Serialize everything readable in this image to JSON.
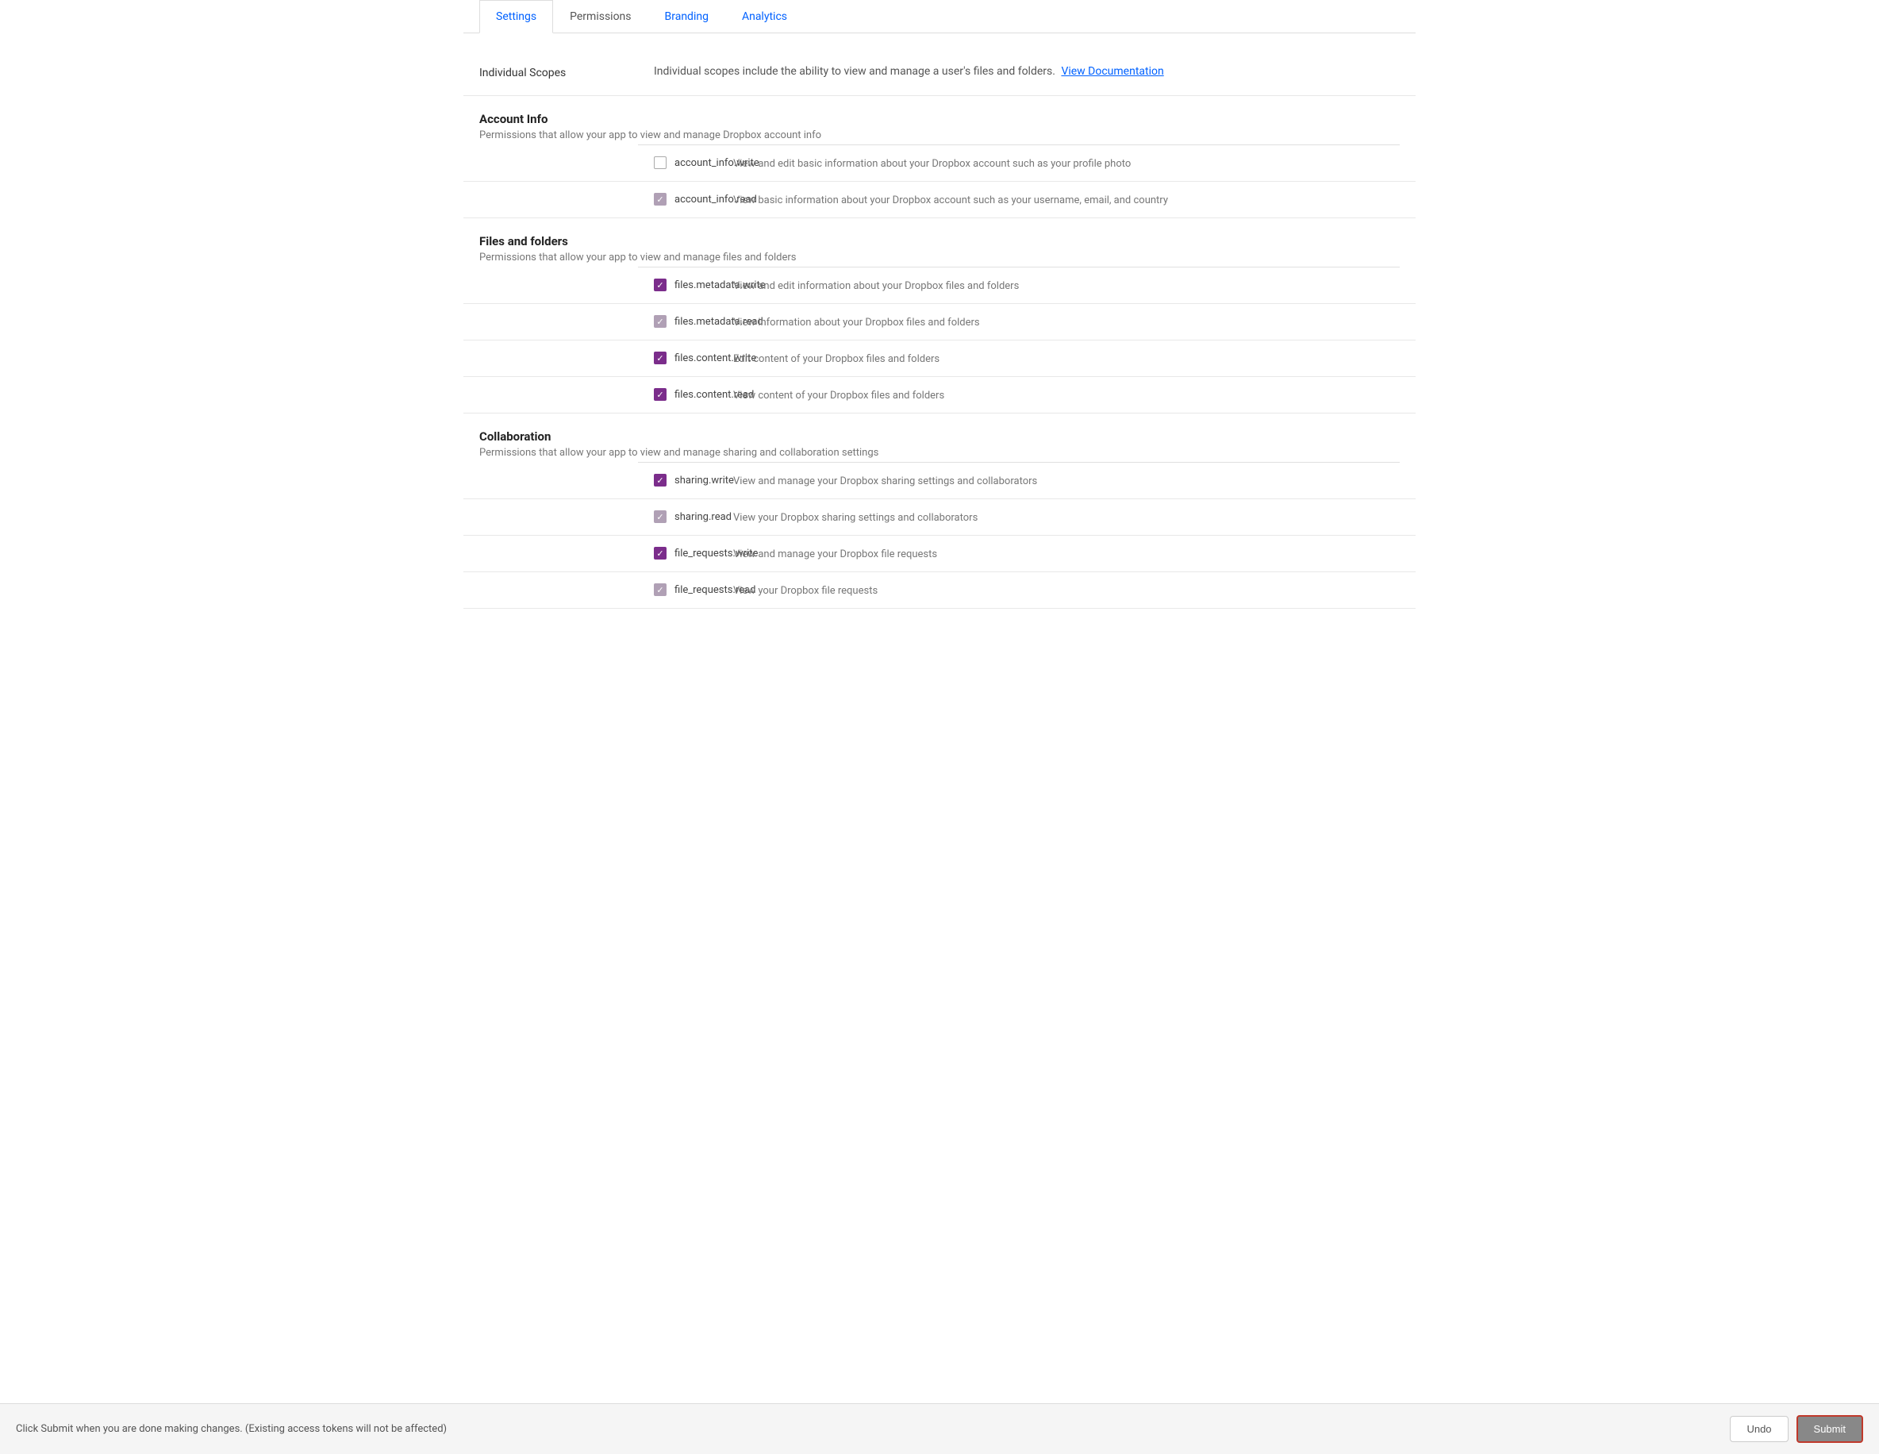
{
  "tabs": [
    {
      "id": "settings",
      "label": "Settings",
      "active": true
    },
    {
      "id": "permissions",
      "label": "Permissions",
      "active": false
    },
    {
      "id": "branding",
      "label": "Branding",
      "active": false
    },
    {
      "id": "analytics",
      "label": "Analytics",
      "active": false
    }
  ],
  "individual_scopes": {
    "label": "Individual Scopes",
    "description": "Individual scopes include the ability to view and manage a user's files and folders.",
    "link_text": "View Documentation",
    "link_href": "#"
  },
  "permission_groups": [
    {
      "id": "account-info",
      "title": "Account Info",
      "subtitle": "Permissions that allow your app to view and manage Dropbox account info",
      "permissions": [
        {
          "id": "account_info_write",
          "name": "account_info.write",
          "checked": false,
          "check_style": "unchecked",
          "description": "View and edit basic information about your Dropbox account such as your profile photo"
        },
        {
          "id": "account_info_read",
          "name": "account_info.read",
          "checked": true,
          "check_style": "gray",
          "description": "View basic information about your Dropbox account such as your username, email, and country"
        }
      ]
    },
    {
      "id": "files-folders",
      "title": "Files and folders",
      "subtitle": "Permissions that allow your app to view and manage files and folders",
      "permissions": [
        {
          "id": "files_metadata_write",
          "name": "files.metadata.write",
          "checked": true,
          "check_style": "purple",
          "description": "View and edit information about your Dropbox files and folders"
        },
        {
          "id": "files_metadata_read",
          "name": "files.metadata.read",
          "checked": true,
          "check_style": "gray",
          "description": "View information about your Dropbox files and folders"
        },
        {
          "id": "files_content_write",
          "name": "files.content.write",
          "checked": true,
          "check_style": "purple",
          "description": "Edit content of your Dropbox files and folders"
        },
        {
          "id": "files_content_read",
          "name": "files.content.read",
          "checked": true,
          "check_style": "purple",
          "description": "View content of your Dropbox files and folders"
        }
      ]
    },
    {
      "id": "collaboration",
      "title": "Collaboration",
      "subtitle": "Permissions that allow your app to view and manage sharing and collaboration settings",
      "permissions": [
        {
          "id": "sharing_write",
          "name": "sharing.write",
          "checked": true,
          "check_style": "purple",
          "description": "View and manage your Dropbox sharing settings and collaborators"
        },
        {
          "id": "sharing_read",
          "name": "sharing.read",
          "checked": true,
          "check_style": "gray",
          "description": "View your Dropbox sharing settings and collaborators"
        },
        {
          "id": "file_requests_write",
          "name": "file_requests.write",
          "checked": true,
          "check_style": "purple",
          "description": "View and manage your Dropbox file requests"
        },
        {
          "id": "file_requests_read",
          "name": "file_requests.read",
          "checked": true,
          "check_style": "gray",
          "description": "View your Dropbox file requests"
        }
      ]
    }
  ],
  "bottom_bar": {
    "message": "Click Submit when you are done making changes. (Existing access tokens will not be affected)",
    "undo_label": "Undo",
    "submit_label": "Submit"
  }
}
